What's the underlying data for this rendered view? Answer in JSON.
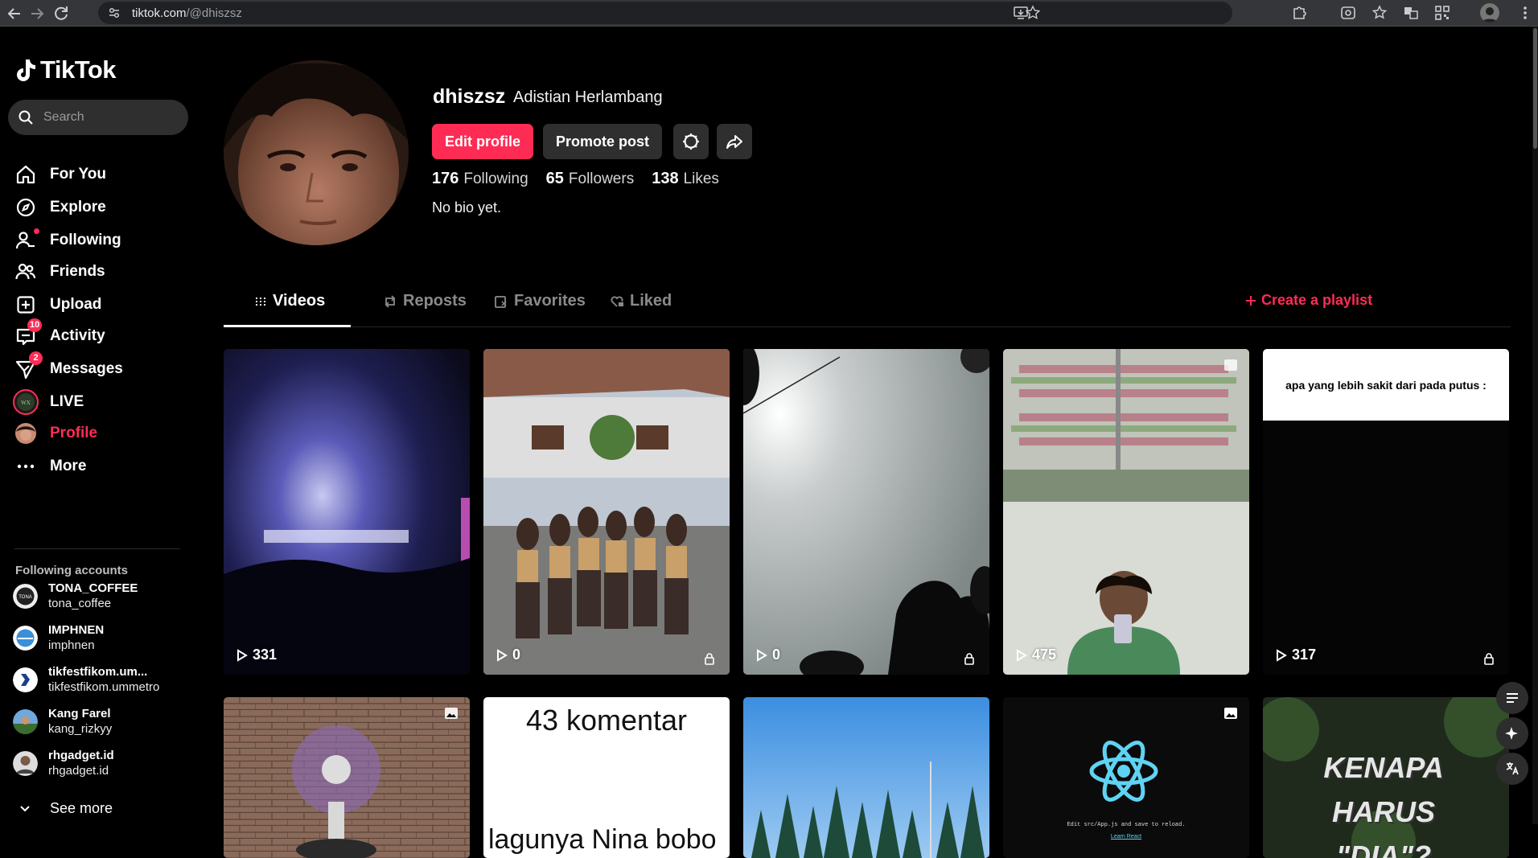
{
  "browser": {
    "url_domain": "tiktok.com",
    "url_path": "/@dhiszsz"
  },
  "sidebar": {
    "logo_text": "TikTok",
    "search_placeholder": "Search",
    "nav": [
      {
        "label": "For You",
        "icon": "home-icon"
      },
      {
        "label": "Explore",
        "icon": "compass-icon"
      },
      {
        "label": "Following",
        "icon": "user-check-icon"
      },
      {
        "label": "Friends",
        "icon": "friends-icon"
      },
      {
        "label": "Upload",
        "icon": "upload-icon"
      },
      {
        "label": "Activity",
        "icon": "activity-icon",
        "badge": "10"
      },
      {
        "label": "Messages",
        "icon": "send-icon",
        "badge": "2"
      },
      {
        "label": "LIVE",
        "icon": "live-avatar-icon"
      },
      {
        "label": "Profile",
        "icon": "profile-avatar-icon"
      },
      {
        "label": "More",
        "icon": "more-icon"
      }
    ],
    "following_title": "Following accounts",
    "accounts": [
      {
        "name": "TONA_COFFEE",
        "handle": "tona_coffee"
      },
      {
        "name": "IMPHNEN",
        "handle": "imphnen"
      },
      {
        "name": "tikfestfikom.um...",
        "handle": "tikfestfikom.ummetro"
      },
      {
        "name": "Kang Farel",
        "handle": "kang_rizkyy"
      },
      {
        "name": "rhgadget.id",
        "handle": "rhgadget.id"
      }
    ],
    "see_more": "See more"
  },
  "profile": {
    "username": "dhiszsz",
    "nickname": "Adistian Herlambang",
    "edit_label": "Edit profile",
    "promote_label": "Promote post",
    "following_count": "176",
    "following_label": "Following",
    "followers_count": "65",
    "followers_label": "Followers",
    "likes_count": "138",
    "likes_label": "Likes",
    "bio": "No bio yet."
  },
  "tabs": {
    "videos": "Videos",
    "reposts": "Reposts",
    "favorites": "Favorites",
    "liked": "Liked",
    "create_playlist": "Create a playlist"
  },
  "videos": [
    {
      "plays": "331",
      "locked": false
    },
    {
      "plays": "0",
      "locked": true
    },
    {
      "plays": "0",
      "locked": true
    },
    {
      "plays": "475",
      "locked": false
    },
    {
      "plays": "317",
      "locked": true,
      "caption": "apa yang lebih sakit dari pada putus :"
    },
    {
      "plays": "",
      "locked": false
    },
    {
      "plays": "",
      "locked": false,
      "caption": "43 komentar",
      "caption2": "lagunya Nina bobo"
    },
    {
      "plays": "",
      "locked": false
    },
    {
      "plays": "",
      "locked": false,
      "caption": "Edit src/App.js and save to reload.",
      "caption2": "Learn React"
    },
    {
      "plays": "",
      "locked": false,
      "caption": "KENAPA HARUS \"DIA\"?"
    }
  ],
  "colors": {
    "accent": "#fe2c55",
    "surface": "#2f2f2f"
  }
}
